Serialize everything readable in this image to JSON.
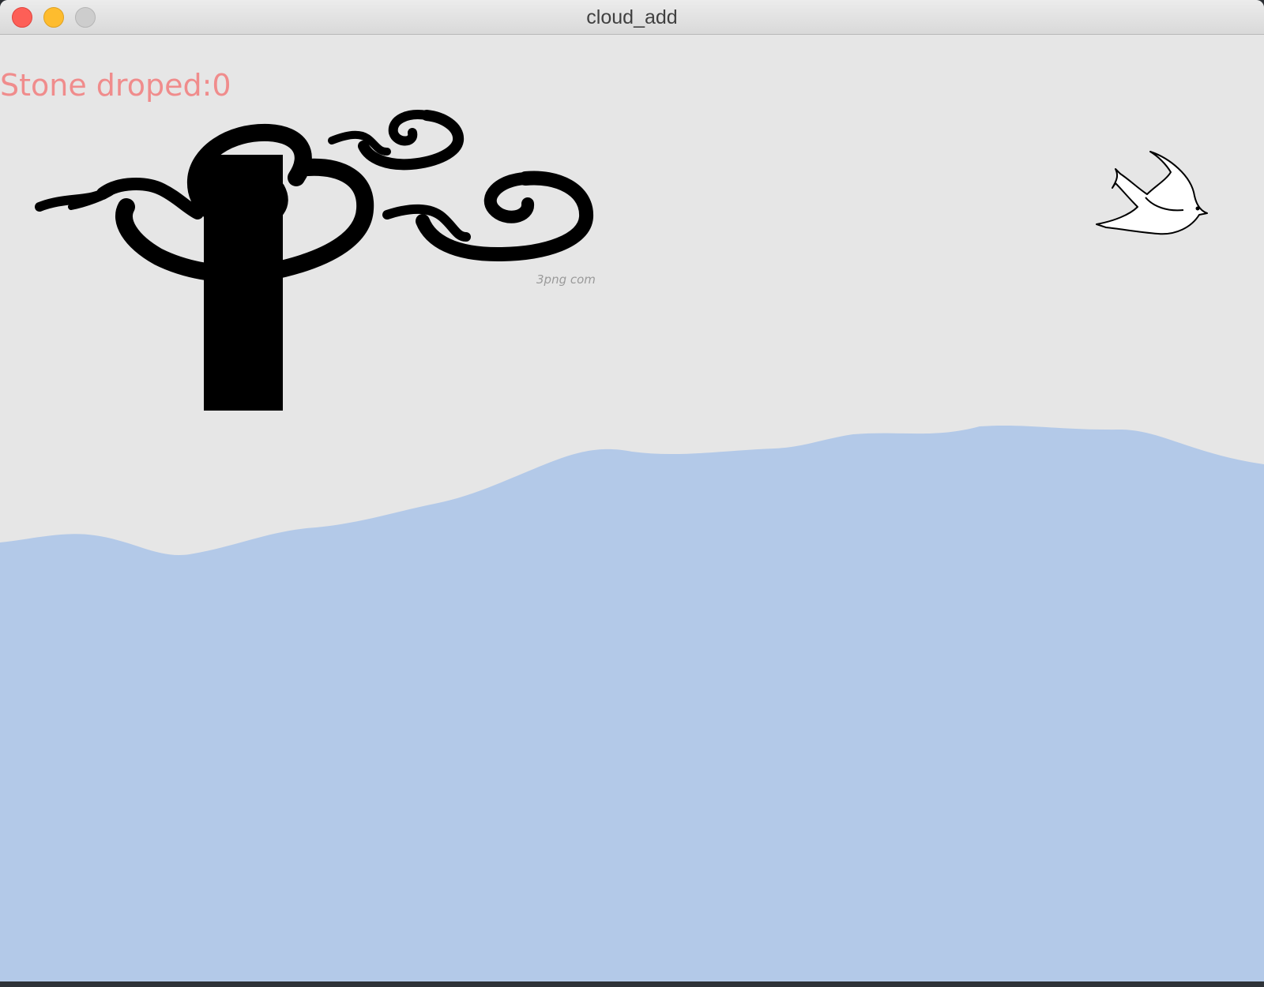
{
  "window": {
    "title": "cloud_add"
  },
  "hud": {
    "score_text": "Stone droped:0"
  },
  "scene": {
    "watermark": "3png com",
    "sky_color": "#e6e6e6",
    "water_color": "#b3c9e8",
    "score_color": "#f08c8c",
    "icons": [
      "cloud-icon",
      "stone-block",
      "swallow-bird-icon"
    ]
  }
}
